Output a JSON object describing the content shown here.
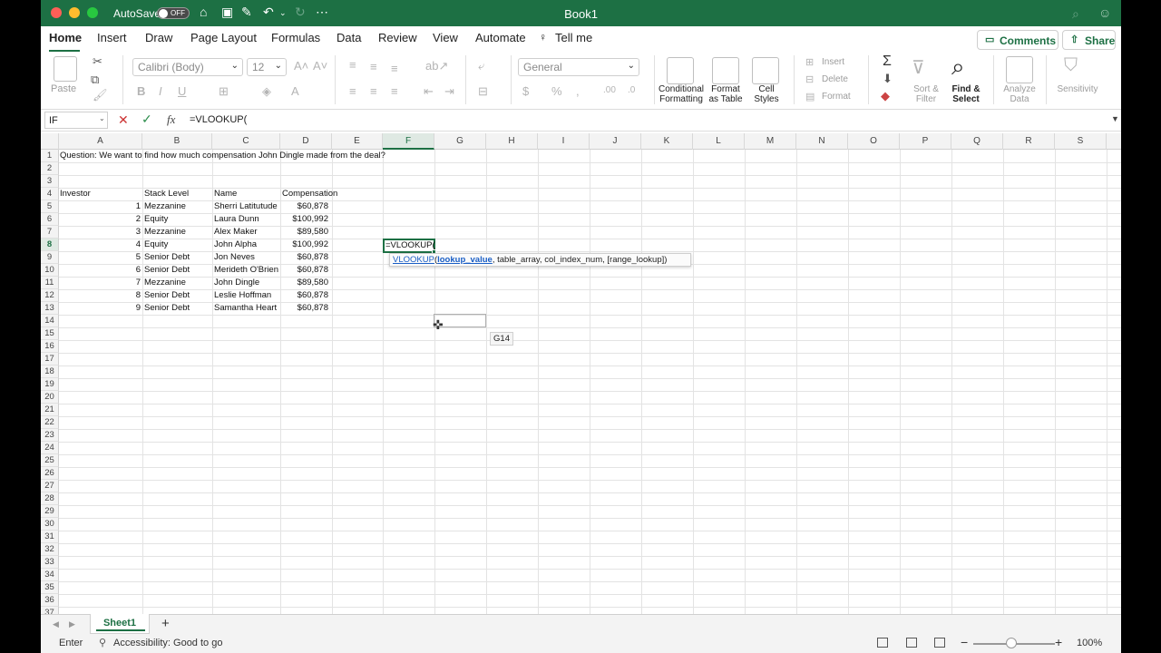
{
  "titlebar": {
    "autosave_label": "AutoSave",
    "autosave_state": "OFF",
    "title": "Book1"
  },
  "tabs": [
    "Home",
    "Insert",
    "Draw",
    "Page Layout",
    "Formulas",
    "Data",
    "Review",
    "View",
    "Automate",
    "Tell me"
  ],
  "actions": {
    "comments": "Comments",
    "share": "Share"
  },
  "ribbon": {
    "paste": "Paste",
    "font_name": "Calibri (Body)",
    "font_size": "12",
    "bold": "B",
    "italic": "I",
    "underline": "U",
    "number_format": "General",
    "conditional_formatting": [
      "Conditional",
      "Formatting"
    ],
    "format_as_table": [
      "Format",
      "as Table"
    ],
    "cell_styles": [
      "Cell",
      "Styles"
    ],
    "insert": "Insert",
    "delete": "Delete",
    "format": "Format",
    "sort_filter": [
      "Sort &",
      "Filter"
    ],
    "find_select": [
      "Find &",
      "Select"
    ],
    "analyze_data": [
      "Analyze",
      "Data"
    ],
    "sensitivity": "Sensitivity"
  },
  "formula_bar": {
    "name_box": "IF",
    "fx": "fx",
    "formula": "=VLOOKUP("
  },
  "columns": [
    "A",
    "B",
    "C",
    "D",
    "E",
    "F",
    "G",
    "H",
    "I",
    "J",
    "K",
    "L",
    "M",
    "N",
    "O",
    "P",
    "Q",
    "R",
    "S"
  ],
  "selected_column": "F",
  "selected_row": "8",
  "rows": [
    "1",
    "2",
    "3",
    "4",
    "5",
    "6",
    "7",
    "8",
    "9",
    "10",
    "11",
    "12",
    "13",
    "14",
    "15",
    "16",
    "17",
    "18",
    "19",
    "20",
    "21",
    "22",
    "23",
    "24",
    "25",
    "26",
    "27",
    "28",
    "29",
    "30",
    "31",
    "32",
    "33",
    "34",
    "35",
    "36",
    "37"
  ],
  "sheet": {
    "question": "Question: We want to find how much compensation John Dingle made from the deal?",
    "headers": [
      "Investor",
      "Stack Level",
      "Name",
      "Compensation"
    ],
    "data": [
      [
        "1",
        "Mezzanine",
        "Sherri Latitutude",
        "$60,878"
      ],
      [
        "2",
        "Equity",
        "Laura Dunn",
        "$100,992"
      ],
      [
        "3",
        "Mezzanine",
        "Alex Maker",
        "$89,580"
      ],
      [
        "4",
        "Equity",
        "John Alpha",
        "$100,992"
      ],
      [
        "5",
        "Senior Debt",
        "Jon Neves",
        "$60,878"
      ],
      [
        "6",
        "Senior Debt",
        "Merideth O'Brien",
        "$60,878"
      ],
      [
        "7",
        "Mezzanine",
        "John Dingle",
        "$89,580"
      ],
      [
        "8",
        "Senior Debt",
        "Leslie Hoffman",
        "$60,878"
      ],
      [
        "9",
        "Senior Debt",
        "Samantha Heart",
        "$60,878"
      ]
    ],
    "active_cell_value": "=VLOOKUP(",
    "hover_tip": "G14"
  },
  "function_tip": {
    "name": "VLOOKUP",
    "open": "(",
    "arg_current": "lookup_value",
    "rest": ", table_array, col_index_num, [range_lookup])"
  },
  "sheet_tabs": {
    "active": "Sheet1",
    "add": "+"
  },
  "status": {
    "mode": "Enter",
    "accessibility": "Accessibility: Good to go",
    "zoom": "100%"
  },
  "colors": {
    "accent": "#1d7044",
    "link": "#1a5ec5"
  }
}
